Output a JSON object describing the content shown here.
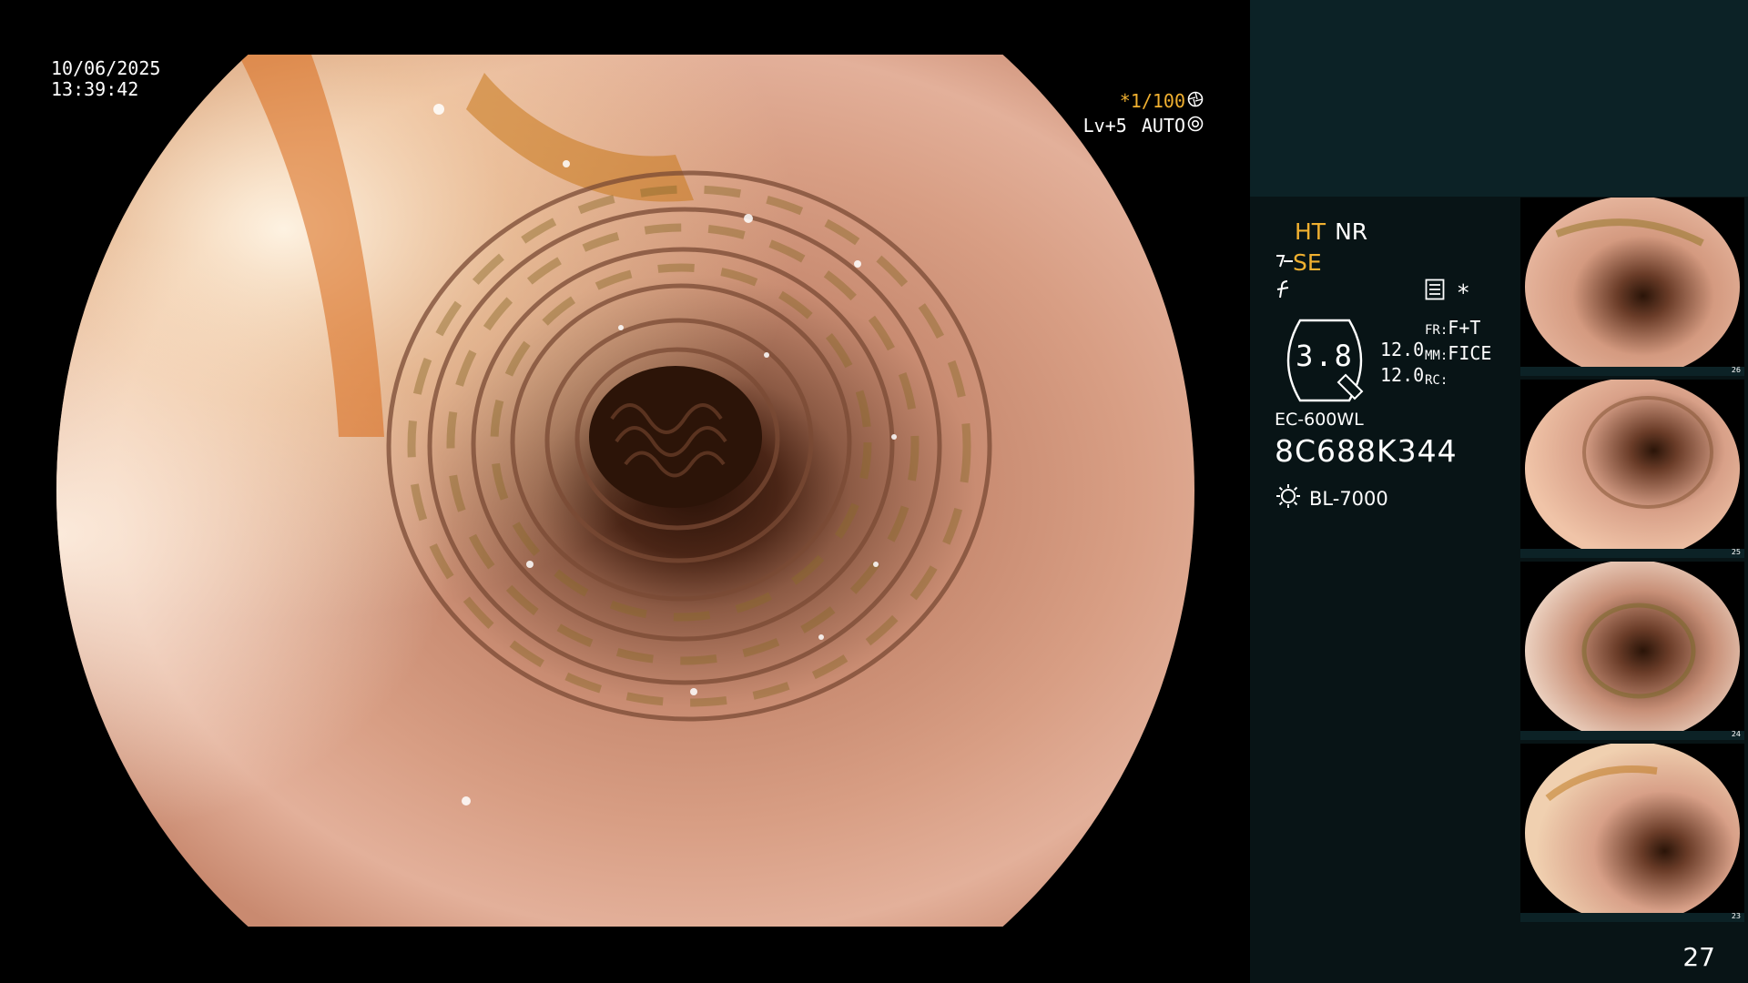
{
  "osd": {
    "date": "10/06/2025",
    "time": "13:39:42",
    "shutter": "*1/100",
    "level": "Lv+5",
    "auto": "AUTO"
  },
  "panel": {
    "ht": "HT",
    "nr": "NR",
    "se": "SE",
    "asterisk": "*",
    "gauge_value": "3.8",
    "gauge_num1": "12.0",
    "gauge_num2": "12.0",
    "fr_label": "FR:",
    "fr_value": "F+T",
    "mm_label": "MM:",
    "mm_value": "FICE",
    "rc_label": "RC:",
    "scope_model": "EC-600WL",
    "scope_serial": "8C688K344",
    "light_source": "BL-7000"
  },
  "thumbnails": [
    {
      "number": "26"
    },
    {
      "number": "25"
    },
    {
      "number": "24"
    },
    {
      "number": "23"
    }
  ],
  "page_number": "27",
  "colors": {
    "amber": "#f0b030",
    "panel_top": "#0c2226",
    "panel": "#081416"
  },
  "icons": [
    "aperture-icon",
    "auto-gear-icon",
    "se-mode-icon",
    "f-mode-icon",
    "menu-icon",
    "zoom-gauge-icon",
    "light-source-icon"
  ]
}
